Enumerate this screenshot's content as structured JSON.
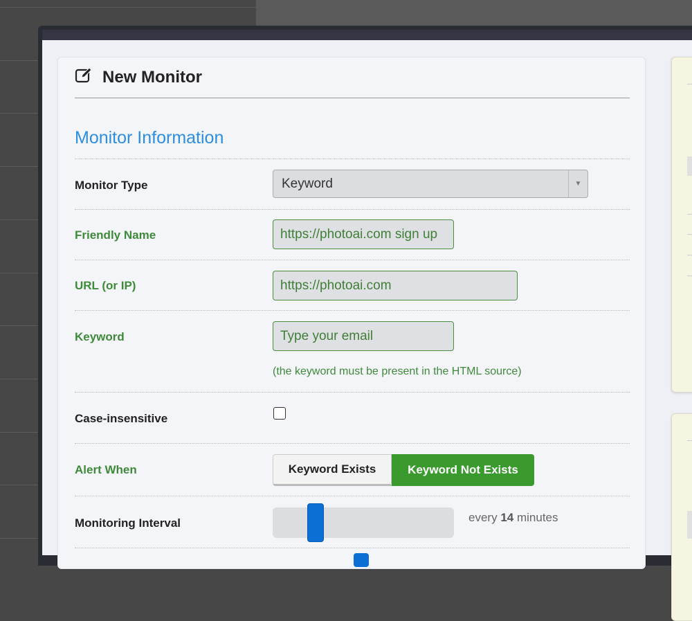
{
  "header": {
    "title": "New Monitor",
    "icon": "edit-icon"
  },
  "section": "Monitor Information",
  "fields": {
    "monitor_type": {
      "label": "Monitor Type",
      "value": "Keyword"
    },
    "friendly_name": {
      "label": "Friendly Name",
      "value": "https://photoai.com sign up"
    },
    "url": {
      "label": "URL (or IP)",
      "value": "https://photoai.com"
    },
    "keyword": {
      "label": "Keyword",
      "value": "Type your email",
      "hint": "(the keyword must be present in the HTML source)"
    },
    "case_insensitive": {
      "label": "Case-insensitive",
      "checked": false
    },
    "alert_when": {
      "label": "Alert When",
      "options": [
        "Keyword Exists",
        "Keyword Not Exists"
      ],
      "selected": "Keyword Not Exists"
    },
    "interval": {
      "label": "Monitoring Interval",
      "prefix": "every",
      "value": "14",
      "suffix": "minutes",
      "fraction": 0.21
    }
  },
  "colors": {
    "accent": "#2d8ee0",
    "green": "#3a9a2e",
    "thumb": "#0b6fd6"
  }
}
